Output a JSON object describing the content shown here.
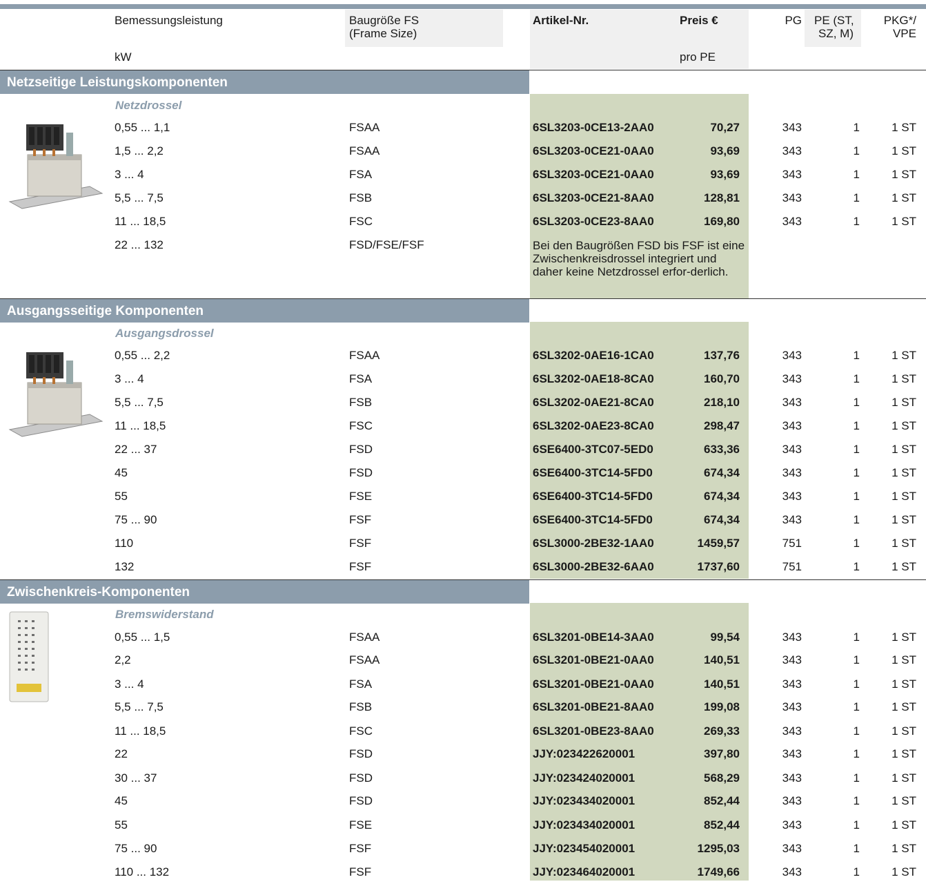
{
  "header": {
    "bemessungsleistung": "Bemessungsleistung",
    "kw": "kW",
    "baugroesse_l1": "Baugröße FS",
    "baugroesse_l2": "(Frame Size)",
    "artikel": "Artikel-Nr.",
    "preis": "Preis €",
    "pro_pe": "pro PE",
    "pg": "PG",
    "pe_l1": "PE (ST,",
    "pe_l2": "SZ, M)",
    "pkg_l1": "PKG*/",
    "pkg_l2": "VPE"
  },
  "sections": [
    {
      "title": "Netzseitige Leistungskomponenten",
      "subtitle": "Netzdrossel",
      "image_icon": "line-reactor-icon",
      "rows": [
        {
          "kw": "0,55 ... 1,1",
          "fs": "FSAA",
          "art": "6SL3203-0CE13-2AA0",
          "price": "70,27",
          "pg": "343",
          "pe": "1",
          "pkg": "1 ST"
        },
        {
          "kw": "1,5 ... 2,2",
          "fs": "FSAA",
          "art": "6SL3203-0CE21-0AA0",
          "price": "93,69",
          "pg": "343",
          "pe": "1",
          "pkg": "1 ST"
        },
        {
          "kw": "3 ... 4",
          "fs": "FSA",
          "art": "6SL3203-0CE21-0AA0",
          "price": "93,69",
          "pg": "343",
          "pe": "1",
          "pkg": "1 ST"
        },
        {
          "kw": "5,5 ... 7,5",
          "fs": "FSB",
          "art": "6SL3203-0CE21-8AA0",
          "price": "128,81",
          "pg": "343",
          "pe": "1",
          "pkg": "1 ST"
        },
        {
          "kw": "11 ... 18,5",
          "fs": "FSC",
          "art": "6SL3203-0CE23-8AA0",
          "price": "169,80",
          "pg": "343",
          "pe": "1",
          "pkg": "1 ST"
        },
        {
          "kw": "22 ... 132",
          "fs": "FSD/FSE/FSF",
          "art": "",
          "price": "",
          "pg": "",
          "pe": "",
          "pkg": ""
        }
      ],
      "note": "Bei den Baugrößen FSD bis FSF ist eine Zwischenkreisdrossel integriert und daher keine Netzdrossel erfor-derlich."
    },
    {
      "title": "Ausgangsseitige Komponenten",
      "subtitle": "Ausgangsdrossel",
      "image_icon": "output-reactor-icon",
      "rows": [
        {
          "kw": "0,55 ... 2,2",
          "fs": "FSAA",
          "art": "6SL3202-0AE16-1CA0",
          "price": "137,76",
          "pg": "343",
          "pe": "1",
          "pkg": "1 ST"
        },
        {
          "kw": "3 ... 4",
          "fs": "FSA",
          "art": "6SL3202-0AE18-8CA0",
          "price": "160,70",
          "pg": "343",
          "pe": "1",
          "pkg": "1 ST"
        },
        {
          "kw": "5,5 ... 7,5",
          "fs": "FSB",
          "art": "6SL3202-0AE21-8CA0",
          "price": "218,10",
          "pg": "343",
          "pe": "1",
          "pkg": "1 ST"
        },
        {
          "kw": "11 ... 18,5",
          "fs": "FSC",
          "art": "6SL3202-0AE23-8CA0",
          "price": "298,47",
          "pg": "343",
          "pe": "1",
          "pkg": "1 ST"
        },
        {
          "kw": "22 ... 37",
          "fs": "FSD",
          "art": "6SE6400-3TC07-5ED0",
          "price": "633,36",
          "pg": "343",
          "pe": "1",
          "pkg": "1 ST"
        },
        {
          "kw": "45",
          "fs": "FSD",
          "art": "6SE6400-3TC14-5FD0",
          "price": "674,34",
          "pg": "343",
          "pe": "1",
          "pkg": "1 ST"
        },
        {
          "kw": "55",
          "fs": "FSE",
          "art": "6SE6400-3TC14-5FD0",
          "price": "674,34",
          "pg": "343",
          "pe": "1",
          "pkg": "1 ST"
        },
        {
          "kw": "75 ... 90",
          "fs": "FSF",
          "art": "6SE6400-3TC14-5FD0",
          "price": "674,34",
          "pg": "343",
          "pe": "1",
          "pkg": "1 ST"
        },
        {
          "kw": "110",
          "fs": "FSF",
          "art": "6SL3000-2BE32-1AA0",
          "price": "1459,57",
          "pg": "751",
          "pe": "1",
          "pkg": "1 ST"
        },
        {
          "kw": "132",
          "fs": "FSF",
          "art": "6SL3000-2BE32-6AA0",
          "price": "1737,60",
          "pg": "751",
          "pe": "1",
          "pkg": "1 ST"
        }
      ]
    },
    {
      "title": "Zwischenkreis-Komponenten",
      "subtitle": "Bremswiderstand",
      "image_icon": "braking-resistor-icon",
      "rows": [
        {
          "kw": "0,55 ... 1,5",
          "fs": "FSAA",
          "art": "6SL3201-0BE14-3AA0",
          "price": "99,54",
          "pg": "343",
          "pe": "1",
          "pkg": "1 ST"
        },
        {
          "kw": "2,2",
          "fs": "FSAA",
          "art": "6SL3201-0BE21-0AA0",
          "price": "140,51",
          "pg": "343",
          "pe": "1",
          "pkg": "1 ST"
        },
        {
          "kw": "3 ... 4",
          "fs": "FSA",
          "art": "6SL3201-0BE21-0AA0",
          "price": "140,51",
          "pg": "343",
          "pe": "1",
          "pkg": "1 ST"
        },
        {
          "kw": "5,5 ... 7,5",
          "fs": "FSB",
          "art": "6SL3201-0BE21-8AA0",
          "price": "199,08",
          "pg": "343",
          "pe": "1",
          "pkg": "1 ST"
        },
        {
          "kw": "11 ... 18,5",
          "fs": "FSC",
          "art": "6SL3201-0BE23-8AA0",
          "price": "269,33",
          "pg": "343",
          "pe": "1",
          "pkg": "1 ST"
        },
        {
          "kw": "22",
          "fs": "FSD",
          "art": "JJY:023422620001",
          "price": "397,80",
          "pg": "343",
          "pe": "1",
          "pkg": "1 ST"
        },
        {
          "kw": "30 ... 37",
          "fs": "FSD",
          "art": "JJY:023424020001",
          "price": "568,29",
          "pg": "343",
          "pe": "1",
          "pkg": "1 ST"
        },
        {
          "kw": "45",
          "fs": "FSD",
          "art": "JJY:023434020001",
          "price": "852,44",
          "pg": "343",
          "pe": "1",
          "pkg": "1 ST"
        },
        {
          "kw": "55",
          "fs": "FSE",
          "art": "JJY:023434020001",
          "price": "852,44",
          "pg": "343",
          "pe": "1",
          "pkg": "1 ST"
        },
        {
          "kw": "75 ... 90",
          "fs": "FSF",
          "art": "JJY:023454020001",
          "price": "1295,03",
          "pg": "343",
          "pe": "1",
          "pkg": "1 ST"
        },
        {
          "kw": "110 ... 132",
          "fs": "FSF",
          "art": "JJY:023464020001",
          "price": "1749,66",
          "pg": "343",
          "pe": "1",
          "pkg": "1 ST"
        }
      ]
    }
  ]
}
